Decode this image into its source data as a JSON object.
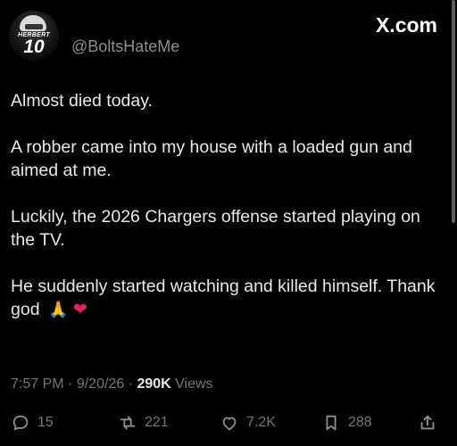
{
  "header": {
    "avatar_name": "HERBERT",
    "avatar_number": "10",
    "handle": "@BoltsHateMe",
    "brand": "X.com"
  },
  "tweet": {
    "line1": "Almost died today.",
    "line2": "A robber came into my house with a loaded gun and aimed at me.",
    "line3": "Luckily, the 2026 Chargers offense started playing on the TV.",
    "line4": "He suddenly started watching and killed himself. Thank god",
    "emoji_1": "🙏",
    "emoji_2": "❤"
  },
  "meta": {
    "time": "7:57 PM",
    "sep": "·",
    "date": "9/20/26",
    "views_count": "290K",
    "views_label": "Views"
  },
  "actions": {
    "replies": "15",
    "reposts": "221",
    "likes": "7.2K",
    "bookmarks": "288"
  }
}
